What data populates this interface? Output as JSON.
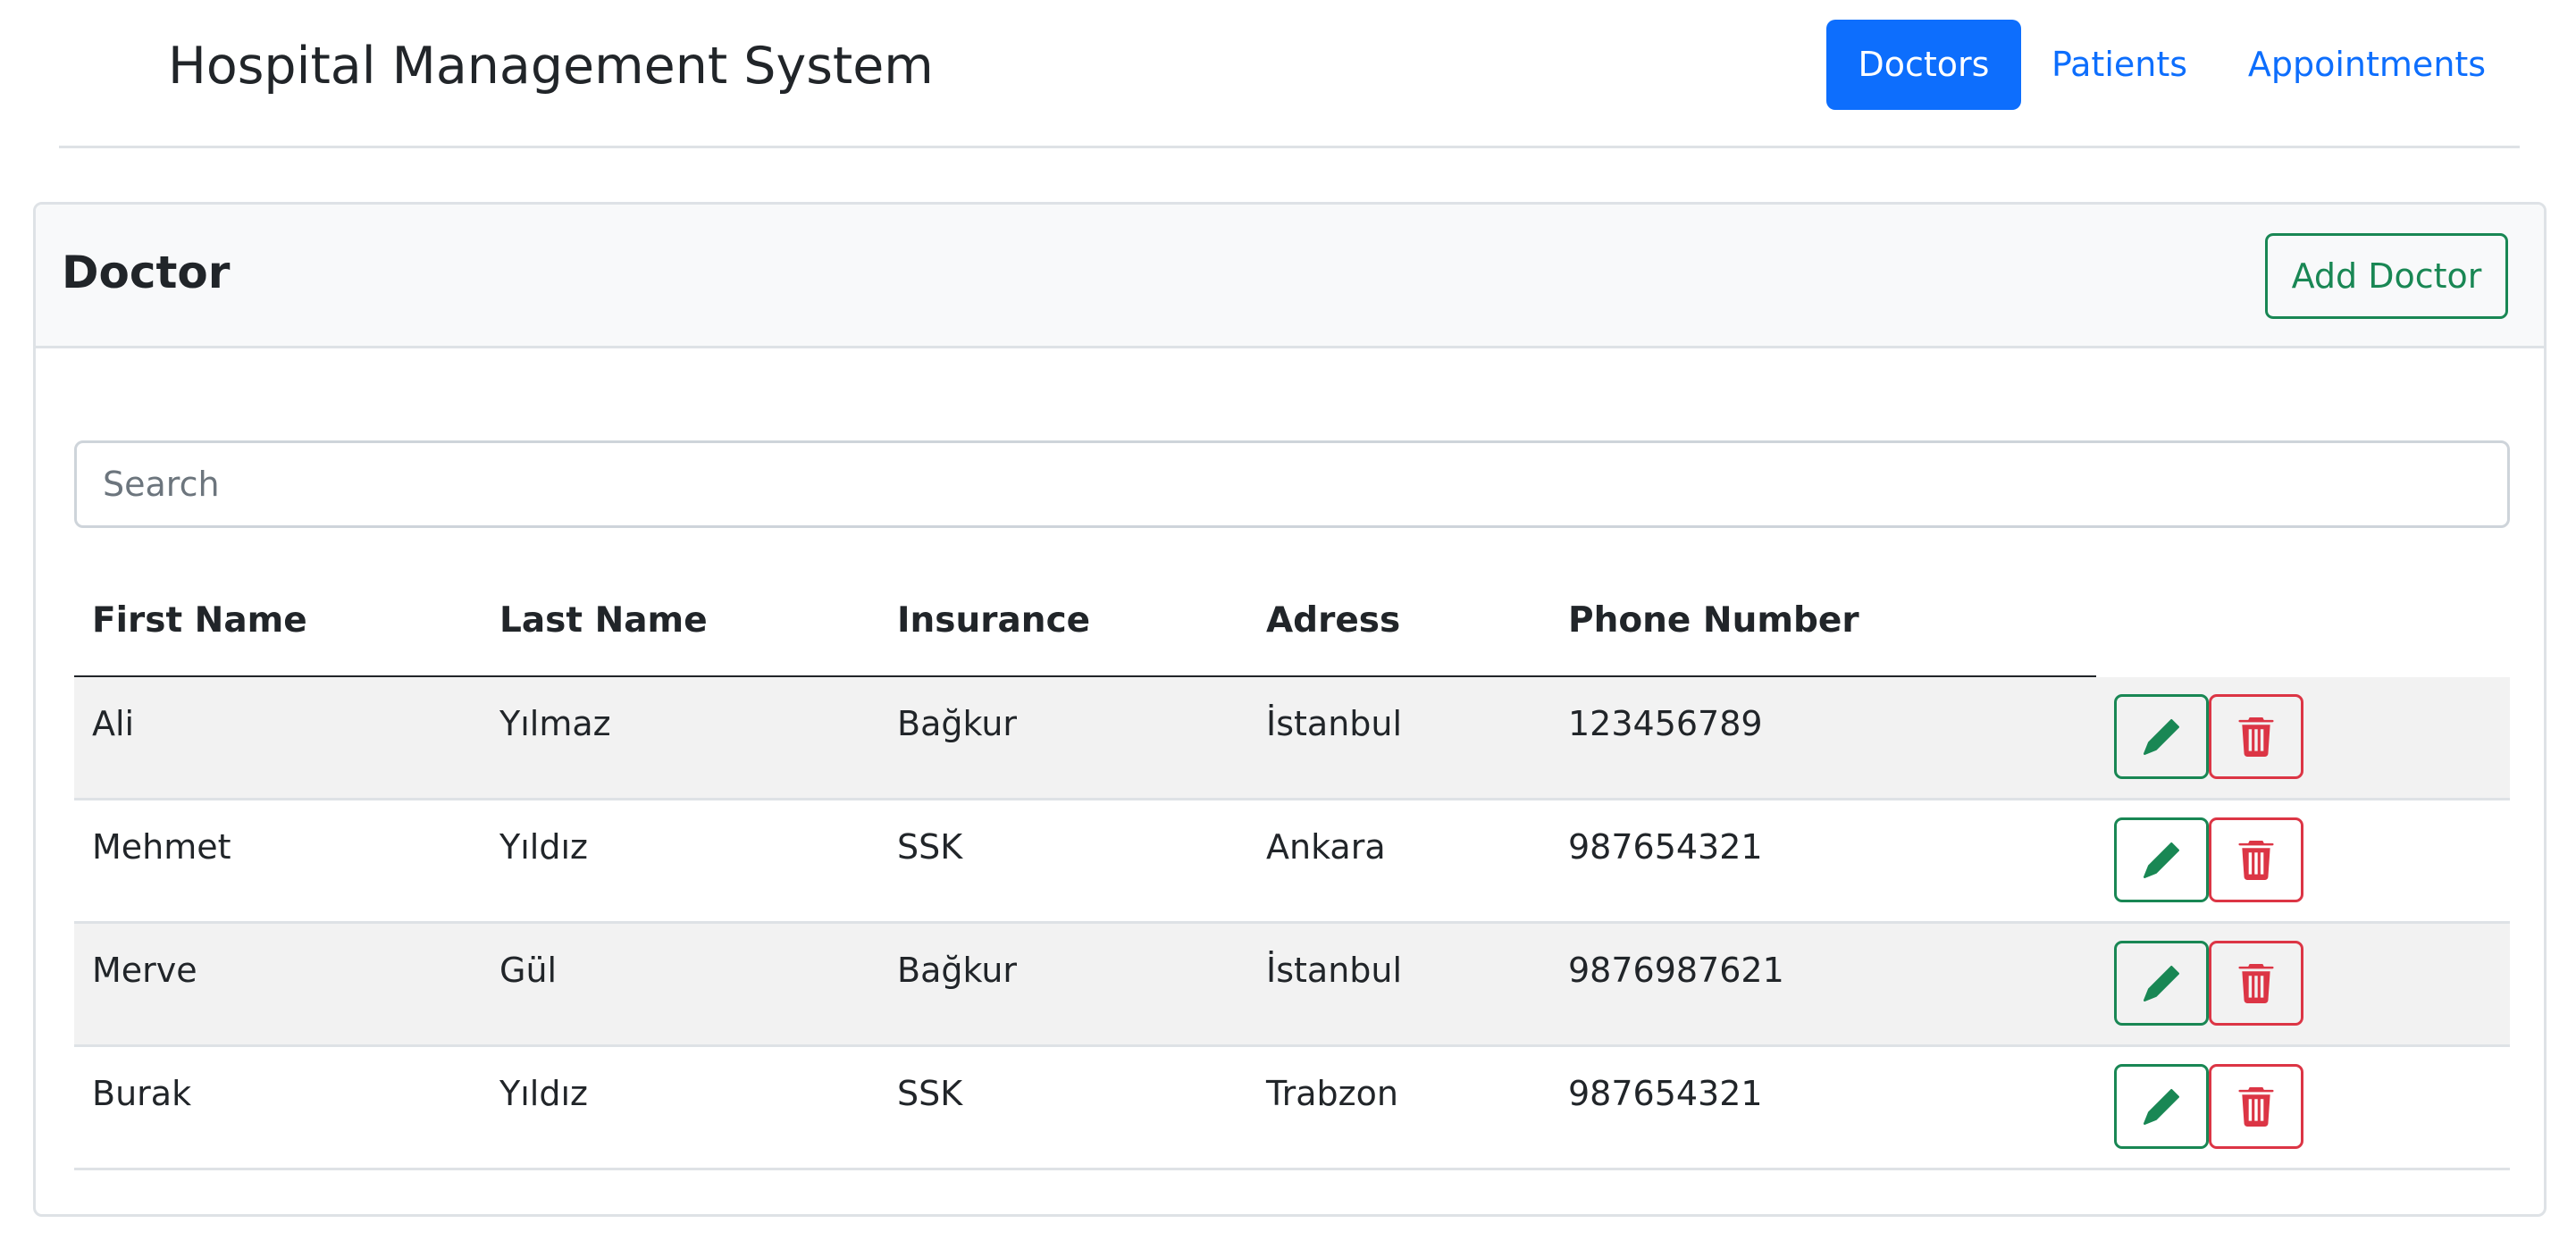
{
  "app": {
    "title": "Hospital Management System"
  },
  "nav": {
    "items": [
      {
        "label": "Doctors",
        "active": true
      },
      {
        "label": "Patients",
        "active": false
      },
      {
        "label": "Appointments",
        "active": false
      }
    ]
  },
  "card": {
    "title": "Doctor",
    "add_button_label": "Add Doctor"
  },
  "search": {
    "placeholder": "Search",
    "value": ""
  },
  "table": {
    "columns": [
      "First Name",
      "Last Name",
      "Insurance",
      "Adress",
      "Phone Number"
    ],
    "rows": [
      [
        "Ali",
        "Yılmaz",
        "Bağkur",
        "İstanbul",
        "123456789"
      ],
      [
        "Mehmet",
        "Yıldız",
        "SSK",
        "Ankara",
        "987654321"
      ],
      [
        "Merve",
        "Gül",
        "Bağkur",
        "İstanbul",
        "9876987621"
      ],
      [
        "Burak",
        "Yıldız",
        "SSK",
        "Trabzon",
        "987654321"
      ]
    ],
    "row_actions": [
      {
        "name": "edit",
        "icon": "pencil-icon"
      },
      {
        "name": "delete",
        "icon": "trash-icon"
      }
    ]
  },
  "colors": {
    "primary": "#0d6efd",
    "success": "#198754",
    "danger": "#dc3545",
    "header_bg": "#f8f9fa",
    "stripe": "#f2f2f2"
  }
}
